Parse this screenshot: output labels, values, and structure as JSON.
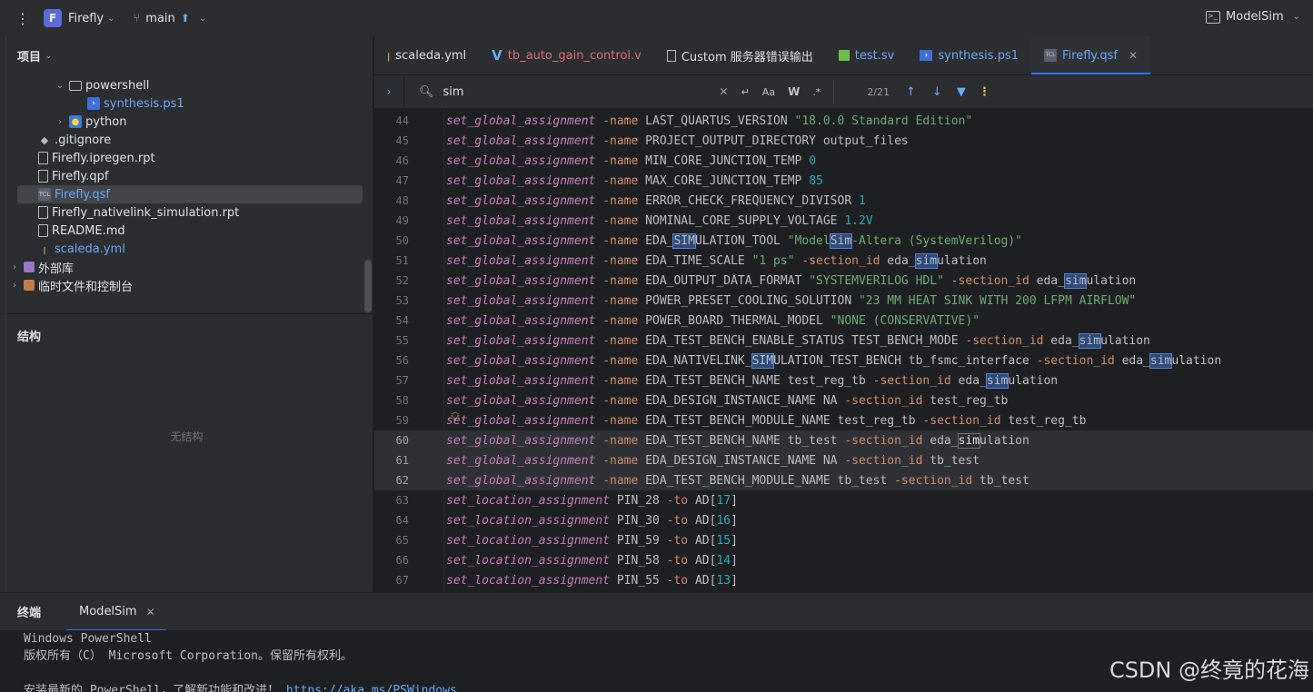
{
  "titlebar": {
    "project_badge": "F",
    "project_name": "Firefly",
    "branch": "main",
    "run_config": "ModelSim"
  },
  "project_panel": {
    "title": "项目",
    "tree": [
      {
        "label": "powershell",
        "type": "folder",
        "expanded": true,
        "depth": 2
      },
      {
        "label": "synthesis.ps1",
        "type": "ps1",
        "depth": 3,
        "color": "#6aa9f8"
      },
      {
        "label": "python",
        "type": "folder",
        "expanded": false,
        "depth": 2
      },
      {
        "label": ".gitignore",
        "type": "git",
        "depth": 1
      },
      {
        "label": "Firefly.ipregen.rpt",
        "type": "file",
        "depth": 1
      },
      {
        "label": "Firefly.qpf",
        "type": "file",
        "depth": 1
      },
      {
        "label": "Firefly.qsf",
        "type": "qsf",
        "depth": 1,
        "selected": true,
        "color": "#6aa9f8"
      },
      {
        "label": "Firefly_nativelink_simulation.rpt",
        "type": "file",
        "depth": 1
      },
      {
        "label": "README.md",
        "type": "md",
        "depth": 1
      },
      {
        "label": "scaleda.yml",
        "type": "yml",
        "depth": 1,
        "color": "#6aa9f8"
      },
      {
        "label": "外部库",
        "type": "lib",
        "depth": 0
      },
      {
        "label": "临时文件和控制台",
        "type": "tmp",
        "depth": 0
      }
    ]
  },
  "structure_panel": {
    "title": "结构",
    "empty_text": "无结构"
  },
  "tabs": [
    {
      "label": "scaleda.yml",
      "icon": "yml-icon"
    },
    {
      "label": "tb_auto_gain_control.v",
      "icon": "verilog-icon",
      "color": "#e06c75"
    },
    {
      "label": "Custom 服务器错误输出",
      "icon": "document-icon"
    },
    {
      "label": "test.sv",
      "icon": "systemverilog-icon",
      "color": "#6aa9f8"
    },
    {
      "label": "synthesis.ps1",
      "icon": "powershell-icon",
      "color": "#6aa9f8"
    },
    {
      "label": "Firefly.qsf",
      "icon": "qsf-icon",
      "active": true
    }
  ],
  "search": {
    "query": "sim",
    "match_case": "Aa",
    "words": "W",
    "regex": ".*",
    "count": "2/21"
  },
  "code_lines": [
    {
      "n": "44",
      "parts": [
        [
          "kw",
          "set_global_assignment"
        ],
        [
          "plain",
          " "
        ],
        [
          "flag",
          "-name"
        ],
        [
          "plain",
          " LAST_QUARTUS_VERSION "
        ],
        [
          "str",
          "\"18.0.0 Standard Edition\""
        ]
      ]
    },
    {
      "n": "45",
      "parts": [
        [
          "kw",
          "set_global_assignment"
        ],
        [
          "plain",
          " "
        ],
        [
          "flag",
          "-name"
        ],
        [
          "plain",
          " PROJECT_OUTPUT_DIRECTORY output_files"
        ]
      ]
    },
    {
      "n": "46",
      "parts": [
        [
          "kw",
          "set_global_assignment"
        ],
        [
          "plain",
          " "
        ],
        [
          "flag",
          "-name"
        ],
        [
          "plain",
          " MIN_CORE_JUNCTION_TEMP "
        ],
        [
          "num",
          "0"
        ]
      ]
    },
    {
      "n": "47",
      "parts": [
        [
          "kw",
          "set_global_assignment"
        ],
        [
          "plain",
          " "
        ],
        [
          "flag",
          "-name"
        ],
        [
          "plain",
          " MAX_CORE_JUNCTION_TEMP "
        ],
        [
          "num",
          "85"
        ]
      ]
    },
    {
      "n": "48",
      "parts": [
        [
          "kw",
          "set_global_assignment"
        ],
        [
          "plain",
          " "
        ],
        [
          "flag",
          "-name"
        ],
        [
          "plain",
          " ERROR_CHECK_FREQUENCY_DIVISOR "
        ],
        [
          "num",
          "1"
        ]
      ]
    },
    {
      "n": "49",
      "parts": [
        [
          "kw",
          "set_global_assignment"
        ],
        [
          "plain",
          " "
        ],
        [
          "flag",
          "-name"
        ],
        [
          "plain",
          " NOMINAL_CORE_SUPPLY_VOLTAGE "
        ],
        [
          "num",
          "1.2V"
        ]
      ]
    },
    {
      "n": "50",
      "parts": [
        [
          "kw",
          "set_global_assignment"
        ],
        [
          "plain",
          " "
        ],
        [
          "flag",
          "-name"
        ],
        [
          "plain",
          " EDA_"
        ],
        [
          "match",
          "SIM"
        ],
        [
          "plain",
          "ULATION_TOOL "
        ],
        [
          "str",
          "\"Model"
        ],
        [
          "match",
          "Sim"
        ],
        [
          "str",
          "-Altera (SystemVerilog)\""
        ]
      ]
    },
    {
      "n": "51",
      "parts": [
        [
          "kw",
          "set_global_assignment"
        ],
        [
          "plain",
          " "
        ],
        [
          "flag",
          "-name"
        ],
        [
          "plain",
          " EDA_TIME_SCALE "
        ],
        [
          "str",
          "\"1 ps\""
        ],
        [
          "plain",
          " "
        ],
        [
          "flag",
          "-section_id"
        ],
        [
          "plain",
          " eda_"
        ],
        [
          "match",
          "sim"
        ],
        [
          "plain",
          "ulation"
        ]
      ]
    },
    {
      "n": "52",
      "parts": [
        [
          "kw",
          "set_global_assignment"
        ],
        [
          "plain",
          " "
        ],
        [
          "flag",
          "-name"
        ],
        [
          "plain",
          " EDA_OUTPUT_DATA_FORMAT "
        ],
        [
          "str",
          "\"SYSTEMVERILOG HDL\""
        ],
        [
          "plain",
          " "
        ],
        [
          "flag",
          "-section_id"
        ],
        [
          "plain",
          " eda_"
        ],
        [
          "match",
          "sim"
        ],
        [
          "plain",
          "ulation"
        ]
      ]
    },
    {
      "n": "53",
      "parts": [
        [
          "kw",
          "set_global_assignment"
        ],
        [
          "plain",
          " "
        ],
        [
          "flag",
          "-name"
        ],
        [
          "plain",
          " POWER_PRESET_COOLING_SOLUTION "
        ],
        [
          "str",
          "\"23 MM HEAT SINK WITH 200 LFPM AIRFLOW\""
        ]
      ]
    },
    {
      "n": "54",
      "parts": [
        [
          "kw",
          "set_global_assignment"
        ],
        [
          "plain",
          " "
        ],
        [
          "flag",
          "-name"
        ],
        [
          "plain",
          " POWER_BOARD_THERMAL_MODEL "
        ],
        [
          "str",
          "\"NONE (CONSERVATIVE)\""
        ]
      ]
    },
    {
      "n": "55",
      "parts": [
        [
          "kw",
          "set_global_assignment"
        ],
        [
          "plain",
          " "
        ],
        [
          "flag",
          "-name"
        ],
        [
          "plain",
          " EDA_TEST_BENCH_ENABLE_STATUS TEST_BENCH_MODE "
        ],
        [
          "flag",
          "-section_id"
        ],
        [
          "plain",
          " eda_"
        ],
        [
          "match",
          "sim"
        ],
        [
          "plain",
          "ulation"
        ]
      ]
    },
    {
      "n": "56",
      "parts": [
        [
          "kw",
          "set_global_assignment"
        ],
        [
          "plain",
          " "
        ],
        [
          "flag",
          "-name"
        ],
        [
          "plain",
          " EDA_NATIVELINK_"
        ],
        [
          "match",
          "SIM"
        ],
        [
          "plain",
          "ULATION_TEST_BENCH tb_fsmc_interface "
        ],
        [
          "flag",
          "-section_id"
        ],
        [
          "plain",
          " eda_"
        ],
        [
          "match",
          "sim"
        ],
        [
          "plain",
          "ulation"
        ]
      ]
    },
    {
      "n": "57",
      "parts": [
        [
          "kw",
          "set_global_assignment"
        ],
        [
          "plain",
          " "
        ],
        [
          "flag",
          "-name"
        ],
        [
          "plain",
          " EDA_TEST_BENCH_NAME test_reg_tb "
        ],
        [
          "flag",
          "-section_id"
        ],
        [
          "plain",
          " eda_"
        ],
        [
          "match",
          "sim"
        ],
        [
          "plain",
          "ulation"
        ]
      ]
    },
    {
      "n": "58",
      "parts": [
        [
          "kw",
          "set_global_assignment"
        ],
        [
          "plain",
          " "
        ],
        [
          "flag",
          "-name"
        ],
        [
          "plain",
          " EDA_DESIGN_INSTANCE_NAME NA "
        ],
        [
          "flag",
          "-section_id"
        ],
        [
          "plain",
          " test_reg_tb"
        ]
      ]
    },
    {
      "n": "59",
      "parts": [
        [
          "kw",
          "set_global_assignment"
        ],
        [
          "plain",
          " "
        ],
        [
          "flag",
          "-name"
        ],
        [
          "plain",
          " EDA_TEST_BENCH_MODULE_NAME test_reg_tb "
        ],
        [
          "flag",
          "-section_id"
        ],
        [
          "plain",
          " test_reg_tb"
        ]
      ]
    },
    {
      "n": "60",
      "hl": true,
      "parts": [
        [
          "kw",
          "set_global_assignment"
        ],
        [
          "plain",
          " "
        ],
        [
          "flag",
          "-name"
        ],
        [
          "plain",
          " EDA_TEST_BENCH_NAME tb_test "
        ],
        [
          "flag",
          "-section_id"
        ],
        [
          "plain",
          " eda_"
        ],
        [
          "matchcur",
          "sim"
        ],
        [
          "plain",
          "ulation"
        ]
      ]
    },
    {
      "n": "61",
      "hl": true,
      "parts": [
        [
          "kw",
          "set_global_assignment"
        ],
        [
          "plain",
          " "
        ],
        [
          "flag",
          "-name"
        ],
        [
          "plain",
          " EDA_DESIGN_INSTANCE_NAME NA "
        ],
        [
          "flag",
          "-section_id"
        ],
        [
          "plain",
          " tb_test"
        ]
      ]
    },
    {
      "n": "62",
      "hl": true,
      "parts": [
        [
          "kw",
          "set_global_assignment"
        ],
        [
          "plain",
          " "
        ],
        [
          "flag",
          "-name"
        ],
        [
          "plain",
          " EDA_TEST_BENCH_MODULE_NAME tb_test "
        ],
        [
          "flag",
          "-section_id"
        ],
        [
          "plain",
          " tb_test"
        ]
      ]
    },
    {
      "n": "63",
      "parts": [
        [
          "kw",
          "set_location_assignment"
        ],
        [
          "plain",
          " PIN_28 "
        ],
        [
          "flag",
          "-to"
        ],
        [
          "plain",
          " AD["
        ],
        [
          "num",
          "17"
        ],
        [
          "plain",
          "]"
        ]
      ]
    },
    {
      "n": "64",
      "parts": [
        [
          "kw",
          "set_location_assignment"
        ],
        [
          "plain",
          " PIN_30 "
        ],
        [
          "flag",
          "-to"
        ],
        [
          "plain",
          " AD["
        ],
        [
          "num",
          "16"
        ],
        [
          "plain",
          "]"
        ]
      ]
    },
    {
      "n": "65",
      "parts": [
        [
          "kw",
          "set_location_assignment"
        ],
        [
          "plain",
          " PIN_59 "
        ],
        [
          "flag",
          "-to"
        ],
        [
          "plain",
          " AD["
        ],
        [
          "num",
          "15"
        ],
        [
          "plain",
          "]"
        ]
      ]
    },
    {
      "n": "66",
      "parts": [
        [
          "kw",
          "set_location_assignment"
        ],
        [
          "plain",
          " PIN_58 "
        ],
        [
          "flag",
          "-to"
        ],
        [
          "plain",
          " AD["
        ],
        [
          "num",
          "14"
        ],
        [
          "plain",
          "]"
        ]
      ]
    },
    {
      "n": "67",
      "parts": [
        [
          "kw",
          "set_location_assignment"
        ],
        [
          "plain",
          " PIN_55 "
        ],
        [
          "flag",
          "-to"
        ],
        [
          "plain",
          " AD["
        ],
        [
          "num",
          "13"
        ],
        [
          "plain",
          "]"
        ]
      ]
    }
  ],
  "terminal": {
    "title": "终端",
    "tab_label": "ModelSim",
    "lines": [
      "Windows PowerShell",
      "版权所有（C） Microsoft Corporation。保留所有权利。",
      ""
    ],
    "partial_line_text": "安装最新的 PowerShell，了解新功能和改进！",
    "partial_line_link": "https://aka.ms/PSWindows"
  },
  "watermark": "CSDN @终竟的花海"
}
